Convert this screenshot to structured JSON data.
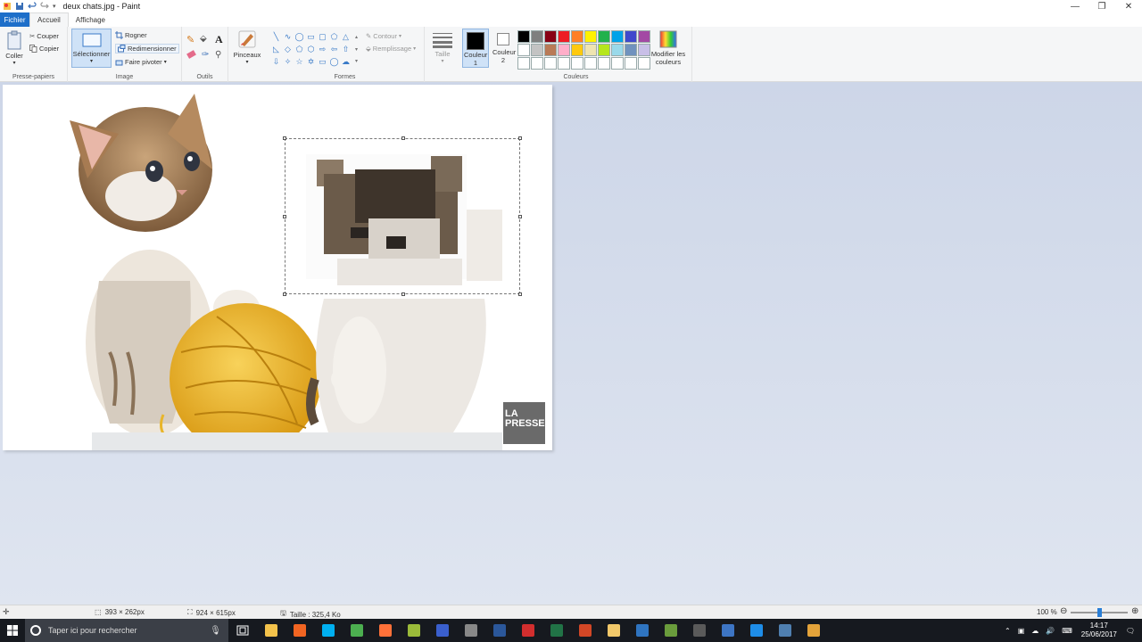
{
  "window": {
    "title": "deux chats.jpg - Paint"
  },
  "tabs": {
    "file": "Fichier",
    "home": "Accueil",
    "view": "Affichage"
  },
  "ribbon": {
    "clipboard": {
      "paste": "Coller",
      "cut": "Couper",
      "copy": "Copier",
      "label": "Presse-papiers"
    },
    "image": {
      "select": "Sélectionner",
      "crop": "Rogner",
      "resize": "Redimensionner",
      "rotate": "Faire pivoter",
      "label": "Image"
    },
    "tools": {
      "label": "Outils",
      "text": "A"
    },
    "brushes": {
      "label": "Pinceaux"
    },
    "shapes": {
      "outline": "Contour",
      "fill": "Remplissage",
      "label": "Formes"
    },
    "size": {
      "label": "Taille"
    },
    "colors": {
      "color1": "Couleur 1",
      "color2": "Couleur 2",
      "edit": "Modifier les couleurs",
      "label": "Couleurs",
      "color1_value": "#000000",
      "color2_value": "#ffffff",
      "palette_row1": [
        "#000000",
        "#7f7f7f",
        "#880015",
        "#ed1c24",
        "#ff7f27",
        "#fff200",
        "#22b14c",
        "#00a2e8",
        "#3f48cc",
        "#a349a4"
      ],
      "palette_row2": [
        "#ffffff",
        "#c3c3c3",
        "#b97a57",
        "#ffaec9",
        "#ffc90e",
        "#efe4b0",
        "#b5e61d",
        "#99d9ea",
        "#7092be",
        "#c8bfe7"
      ],
      "palette_row3": [
        "#ffffff",
        "#ffffff",
        "#ffffff",
        "#ffffff",
        "#ffffff",
        "#ffffff",
        "#ffffff",
        "#ffffff",
        "#ffffff",
        "#ffffff"
      ]
    }
  },
  "canvas": {
    "watermark": "LA PRESSE",
    "watermark_line1": "LA",
    "watermark_line2": "PRESSE"
  },
  "status": {
    "selection_size": "393 × 262px",
    "image_size": "924 × 615px",
    "file_size": "Taille : 325,4 Ko",
    "zoom": "100 %"
  },
  "taskbar": {
    "search_placeholder": "Taper ici pour rechercher",
    "time": "14:17",
    "date": "25/06/2017",
    "apps": [
      {
        "name": "file-explorer-app",
        "color": "#f3c24b"
      },
      {
        "name": "orange-app",
        "color": "#f26522"
      },
      {
        "name": "skype-app",
        "color": "#00aff0"
      },
      {
        "name": "chrome-app",
        "color": "#4caf50"
      },
      {
        "name": "firefox-app",
        "color": "#ff7139"
      },
      {
        "name": "gimp-app",
        "color": "#9bbb3a"
      },
      {
        "name": "download-app",
        "color": "#3a5fcd"
      },
      {
        "name": "quicktime-app",
        "color": "#888888"
      },
      {
        "name": "word-app",
        "color": "#2b579a"
      },
      {
        "name": "acrobat-app",
        "color": "#d22e2e"
      },
      {
        "name": "excel-app",
        "color": "#217346"
      },
      {
        "name": "powerpoint-app",
        "color": "#d24726"
      },
      {
        "name": "notepad-app",
        "color": "#f1c86a"
      },
      {
        "name": "installer-app",
        "color": "#2f74c0"
      },
      {
        "name": "minecraft-app",
        "color": "#6a9c3c"
      },
      {
        "name": "media-app",
        "color": "#5a5a5a"
      },
      {
        "name": "virtualbox-app",
        "color": "#3d75c4"
      },
      {
        "name": "outlook-app",
        "color": "#1e8de8"
      },
      {
        "name": "screen-app",
        "color": "#4f7fb0"
      },
      {
        "name": "paint-app",
        "color": "#e3a33a"
      }
    ]
  }
}
